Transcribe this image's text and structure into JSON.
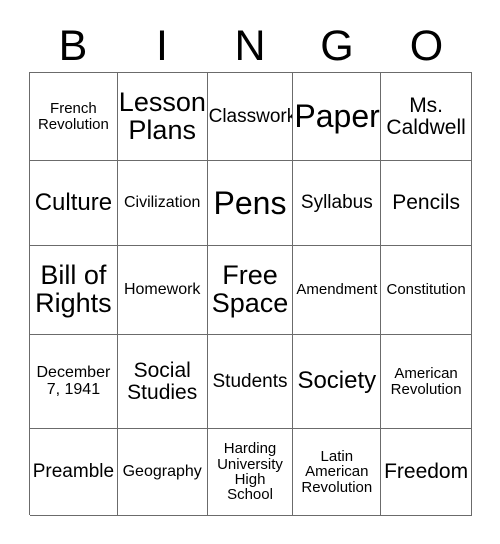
{
  "header": {
    "letters": [
      "B",
      "I",
      "N",
      "G",
      "O"
    ]
  },
  "grid": {
    "rows": [
      [
        {
          "text": "French\nRevolution",
          "size": "fs-s"
        },
        {
          "text": "Lesson\nPlans",
          "size": "fs-xl"
        },
        {
          "text": "Classwork",
          "size": "fs-m"
        },
        {
          "text": "Paper",
          "size": "fs-xxl"
        },
        {
          "text": "Ms.\nCaldwell",
          "size": "fs-ml"
        }
      ],
      [
        {
          "text": "Culture",
          "size": "fs-l"
        },
        {
          "text": "Civilization",
          "size": "fs-sm"
        },
        {
          "text": "Pens",
          "size": "fs-xxl"
        },
        {
          "text": "Syllabus",
          "size": "fs-m"
        },
        {
          "text": "Pencils",
          "size": "fs-ml"
        }
      ],
      [
        {
          "text": "Bill of\nRights",
          "size": "fs-xl"
        },
        {
          "text": "Homework",
          "size": "fs-sm"
        },
        {
          "text": "Free\nSpace",
          "size": "fs-xl"
        },
        {
          "text": "Amendment",
          "size": "fs-s"
        },
        {
          "text": "Constitution",
          "size": "fs-s"
        }
      ],
      [
        {
          "text": "December\n7, 1941",
          "size": "fs-sm"
        },
        {
          "text": "Social\nStudies",
          "size": "fs-ml"
        },
        {
          "text": "Students",
          "size": "fs-m"
        },
        {
          "text": "Society",
          "size": "fs-l"
        },
        {
          "text": "American\nRevolution",
          "size": "fs-s"
        }
      ],
      [
        {
          "text": "Preamble",
          "size": "fs-m"
        },
        {
          "text": "Geography",
          "size": "fs-sm"
        },
        {
          "text": "Harding\nUniversity\nHigh\nSchool",
          "size": "fs-s"
        },
        {
          "text": "Latin\nAmerican\nRevolution",
          "size": "fs-s"
        },
        {
          "text": "Freedom",
          "size": "fs-ml"
        }
      ]
    ]
  },
  "colors": {
    "border": "#6b6b6b",
    "text": "#000000",
    "background": "#ffffff"
  }
}
